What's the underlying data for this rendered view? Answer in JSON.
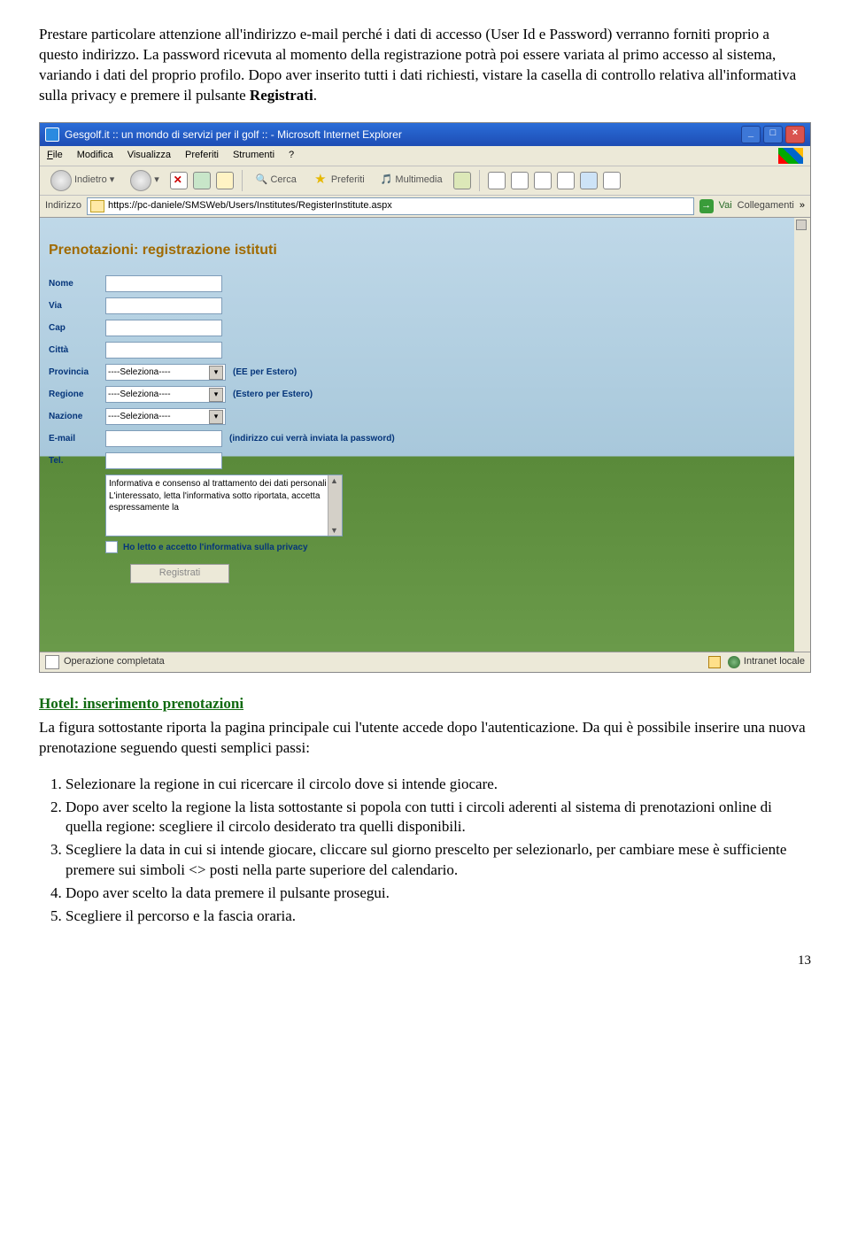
{
  "para1": {
    "a": "Prestare particolare attenzione all'indirizzo e-mail perché i dati di accesso (User Id e Password) verranno forniti proprio a questo indirizzo. La password ricevuta al momento della registrazione potrà poi essere variata al primo accesso al sistema, variando i dati del proprio profilo. Dopo aver inserito tutti i dati richiesti, vistare la casella di controllo relativa all'informativa sulla privacy e premere il pulsante ",
    "b": "Registrati",
    "c": "."
  },
  "shot": {
    "title": "Gesgolf.it :: un mondo di servizi per il golf :: - Microsoft Internet Explorer",
    "menu": {
      "file": "File",
      "modifica": "Modifica",
      "visualizza": "Visualizza",
      "preferiti": "Preferiti",
      "strumenti": "Strumenti",
      "help": "?"
    },
    "toolbar": {
      "indietro": "Indietro",
      "cerca": "Cerca",
      "preferiti": "Preferiti",
      "multimedia": "Multimedia"
    },
    "addr": {
      "label": "Indirizzo",
      "url": "https://pc-daniele/SMSWeb/Users/Institutes/RegisterInstitute.aspx",
      "go": "Vai",
      "coll": "Collegamenti"
    },
    "form": {
      "title": "Prenotazioni: registrazione istituti",
      "nome": "Nome",
      "via": "Via",
      "cap": "Cap",
      "citta": "Città",
      "provincia": "Provincia",
      "regione": "Regione",
      "nazione": "Nazione",
      "email": "E-mail",
      "tel": "Tel.",
      "select_placeholder": "----Seleziona----",
      "hint_prov": "(EE per Estero)",
      "hint_reg": "(Estero per Estero)",
      "hint_email": "(indirizzo cui verrà inviata la password)",
      "info": "Informativa e consenso al trattamento dei dati personali\n\nL'interessato, letta l'informativa sotto riportata, accetta espressamente la",
      "chk": "Ho letto e accetto l'informativa sulla privacy",
      "btn": "Registrati"
    },
    "status": {
      "done": "Operazione completata",
      "zone": "Intranet locale"
    }
  },
  "section": {
    "title": "Hotel: inserimento prenotazioni",
    "intro": "La figura sottostante riporta la pagina principale cui l'utente accede dopo l'autenticazione. Da qui è possibile inserire una nuova prenotazione seguendo questi semplici passi:",
    "steps": [
      "Selezionare la regione in cui ricercare il circolo dove si intende giocare.",
      "Dopo aver scelto la regione la lista sottostante si popola con tutti i circoli aderenti al sistema di prenotazioni online di quella regione: scegliere il circolo desiderato tra quelli disponibili.",
      "Scegliere la data in cui si intende giocare, cliccare sul giorno prescelto per selezionarlo, per cambiare mese è sufficiente premere sui simboli <> posti nella parte superiore del calendario.",
      "Dopo aver scelto la data premere il pulsante prosegui.",
      "Scegliere il percorso e la fascia oraria."
    ]
  },
  "page": "13"
}
